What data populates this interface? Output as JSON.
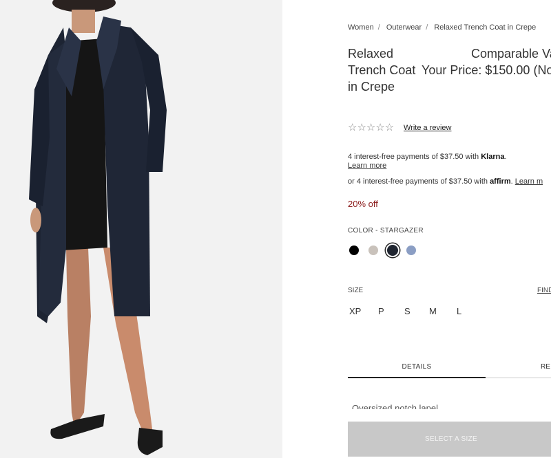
{
  "breadcrumb": [
    "Women",
    "Outerwear",
    "Relaxed Trench Coat in Crepe"
  ],
  "product": {
    "title": "Relaxed Trench Coat in Crepe",
    "comparable_value": "Comparable Va",
    "your_price": "Your Price: $150.00 (No",
    "rating_stars": "☆☆☆☆☆",
    "write_review": "Write a review",
    "discount": "20% off"
  },
  "payments": {
    "klarna_prefix": "4 interest-free payments of $37.50 with ",
    "klarna_brand": "Klarna",
    "klarna_suffix": ".",
    "klarna_learn": "Learn more",
    "affirm_prefix": "or 4 interest-free payments of $37.50 with ",
    "affirm_brand": "affirm",
    "affirm_suffix": ". ",
    "affirm_learn": "Learn m"
  },
  "color": {
    "label": "COLOR - STARGAZER",
    "swatches": [
      {
        "name": "black",
        "hex": "#000000"
      },
      {
        "name": "beige",
        "hex": "#c9c2bb"
      },
      {
        "name": "stargazer",
        "hex": "#1f2530"
      },
      {
        "name": "blue",
        "hex": "#8b9ec4"
      }
    ]
  },
  "size": {
    "label": "SIZE",
    "find_size": "FIND",
    "options": [
      "XP",
      "P",
      "S",
      "M",
      "L"
    ]
  },
  "tabs": {
    "details": "DETAILS",
    "reviews": "RE"
  },
  "details_text": "Oversized notch lapel",
  "cta": {
    "select_size": "SELECT A SIZE"
  }
}
